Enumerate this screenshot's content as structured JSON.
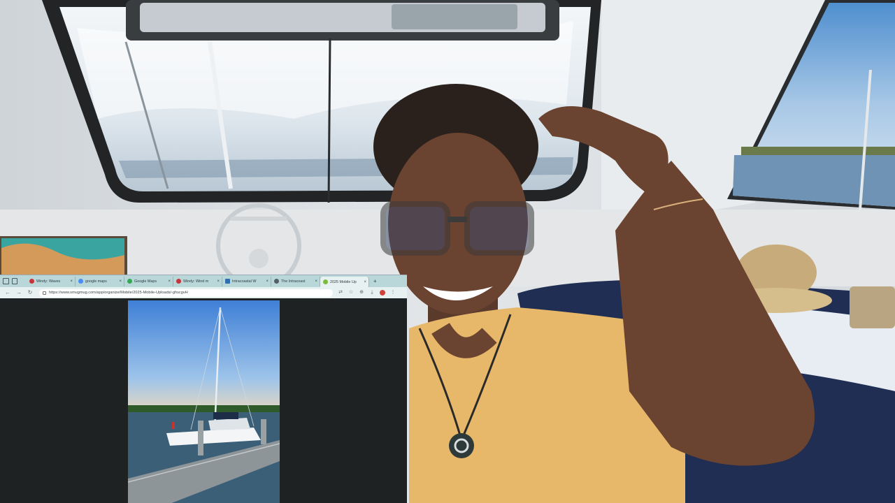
{
  "video": {
    "scene": "host-in-catamaran-cabin"
  },
  "browser": {
    "tabs": [
      {
        "label": "Windy: Waves",
        "favicon_color": "#c9343a"
      },
      {
        "label": "google maps",
        "favicon_color": "#4a8df6"
      },
      {
        "label": "Google Maps",
        "favicon_color": "#34a853"
      },
      {
        "label": "Windy: Wind m",
        "favicon_color": "#c9343a"
      },
      {
        "label": "Intracoastal W",
        "favicon_color": "#2f6fb0"
      },
      {
        "label": "The Intracoast",
        "favicon_color": "#556066"
      },
      {
        "label": "2025 Mobile Up",
        "favicon_color": "#7dbb3c",
        "active": true
      }
    ],
    "new_tab_label": "+",
    "url": "https://www.smugmug.com/app/organize/Mobile/2025-Mobile-Uploads/-ghscgvH"
  },
  "colors": {
    "tabstrip": "#b9d6d9",
    "toolbar": "#e8f1f2",
    "viewport": "#1f2223",
    "shirt": "#e8b86a"
  }
}
